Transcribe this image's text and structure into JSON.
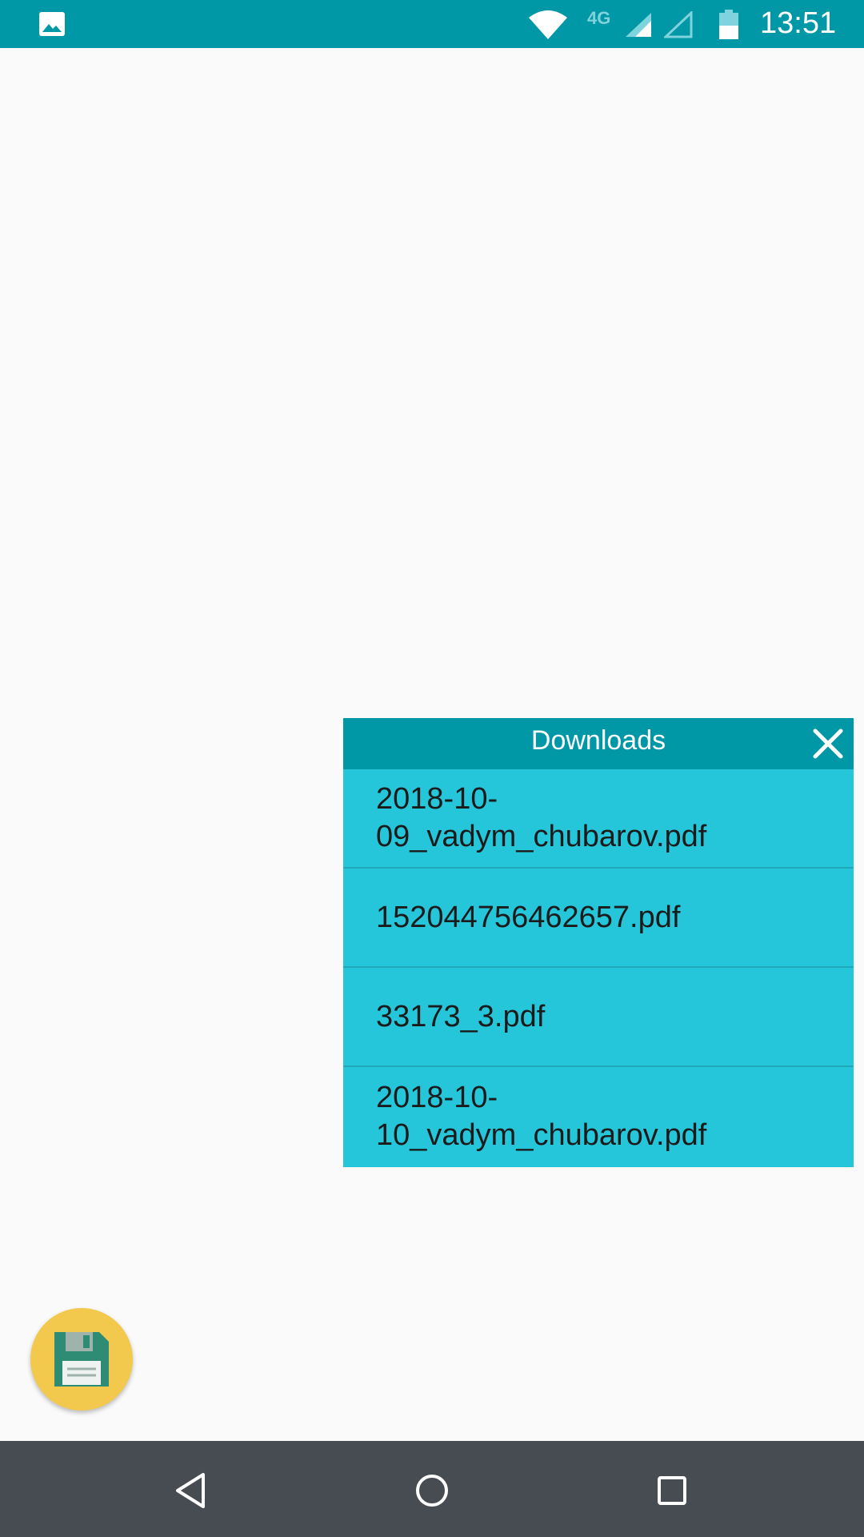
{
  "status_bar": {
    "time": "13:51",
    "network_type": "4G",
    "icons": [
      "image-notification-icon",
      "wifi-icon",
      "signal-icon",
      "signal-empty-icon",
      "battery-icon"
    ]
  },
  "downloads": {
    "title": "Downloads",
    "close_icon": "close-icon",
    "files": [
      {
        "name": "2018-10-09_vadym_chubarov.pdf",
        "line1": "2018-10-",
        "line2": "09_vadym_chubarov.pdf"
      },
      {
        "name": "152044756462657.pdf",
        "line1": "152044756462657.pdf",
        "line2": ""
      },
      {
        "name": "33173_3.pdf",
        "line1": "33173_3.pdf",
        "line2": ""
      },
      {
        "name": "2018-10-10_vadym_chubarov.pdf",
        "line1": "2018-10-",
        "line2": "10_vadym_chubarov.pdf"
      }
    ]
  },
  "fab": {
    "icon": "save-icon"
  },
  "nav_bar": {
    "icons": [
      "back-icon",
      "home-icon",
      "recents-icon"
    ]
  },
  "colors": {
    "primary": "#0097a7",
    "list_background": "#26c6da",
    "fab": "#f2c94c",
    "nav_bar": "#474c52",
    "background": "#fafafa"
  }
}
